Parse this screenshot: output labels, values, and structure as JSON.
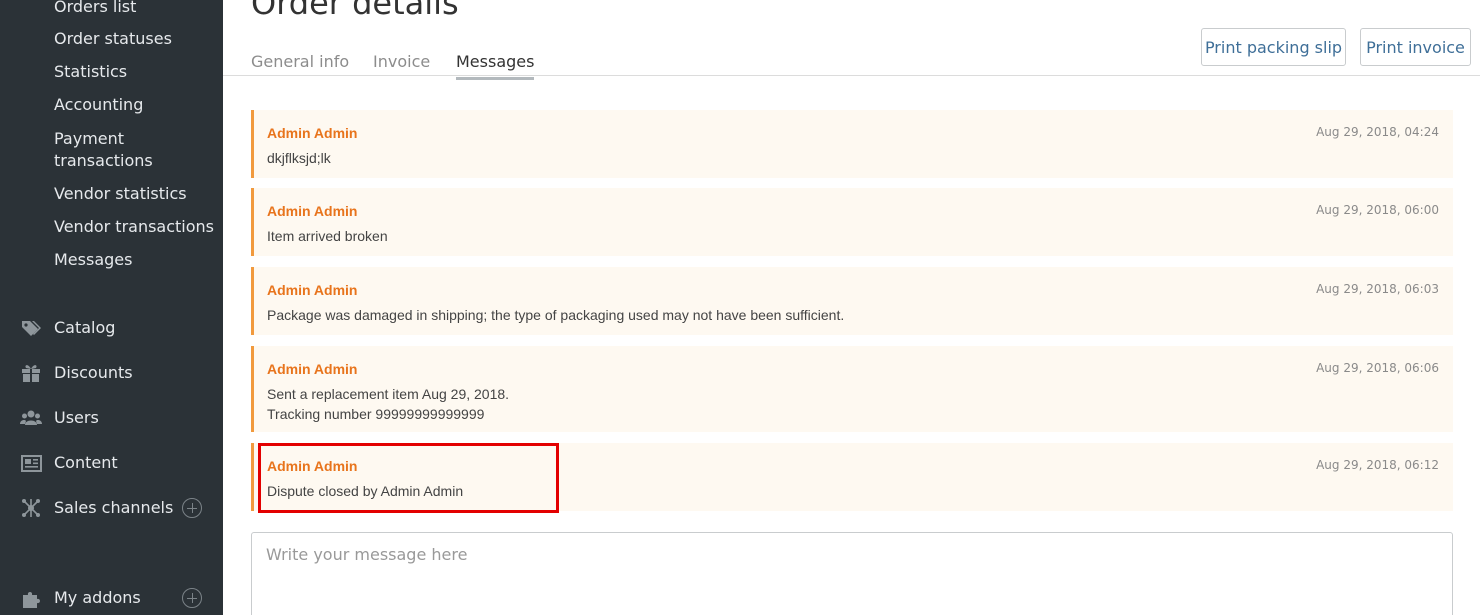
{
  "sidebar": {
    "sub_items": [
      "Orders list",
      "Order statuses",
      "Statistics",
      "Accounting",
      "Payment",
      "transactions",
      "Vendor statistics",
      "Vendor transactions",
      "Messages"
    ],
    "main_items": [
      {
        "label": "Catalog",
        "icon": "tags-icon"
      },
      {
        "label": "Discounts",
        "icon": "gift-icon"
      },
      {
        "label": "Users",
        "icon": "users-icon"
      },
      {
        "label": "Content",
        "icon": "newspaper-icon"
      },
      {
        "label": "Sales channels",
        "icon": "network-icon"
      },
      {
        "label": "My addons",
        "icon": "puzzle-icon"
      }
    ]
  },
  "header": {
    "title": "Order details",
    "tabs": [
      "General info",
      "Invoice",
      "Messages"
    ],
    "active_tab": "Messages",
    "print_packing_slip": "Print packing slip",
    "print_invoice": "Print invoice"
  },
  "messages": [
    {
      "author": "Admin Admin",
      "time": "Aug 29, 2018, 04:24",
      "lines": [
        "dkjflksjd;lk"
      ]
    },
    {
      "author": "Admin Admin",
      "time": "Aug 29, 2018, 06:00",
      "lines": [
        "Item arrived broken"
      ]
    },
    {
      "author": "Admin Admin",
      "time": "Aug 29, 2018, 06:03",
      "lines": [
        "Package was damaged in shipping; the type of packaging used may not have been sufficient."
      ]
    },
    {
      "author": "Admin Admin",
      "time": "Aug 29, 2018, 06:06",
      "lines": [
        "Sent a replacement item Aug 29, 2018.",
        "Tracking number 99999999999999"
      ]
    },
    {
      "author": "Admin Admin",
      "time": "Aug 29, 2018, 06:12",
      "lines": [
        "Dispute closed by Admin Admin"
      ]
    }
  ],
  "composer": {
    "placeholder": "Write your message here"
  },
  "colors": {
    "sidebar_bg": "#2b3237",
    "accent_orange": "#e8741c",
    "message_bg": "#fef9f1",
    "highlight_red": "#e30000",
    "link_blue": "#3f6f98"
  }
}
